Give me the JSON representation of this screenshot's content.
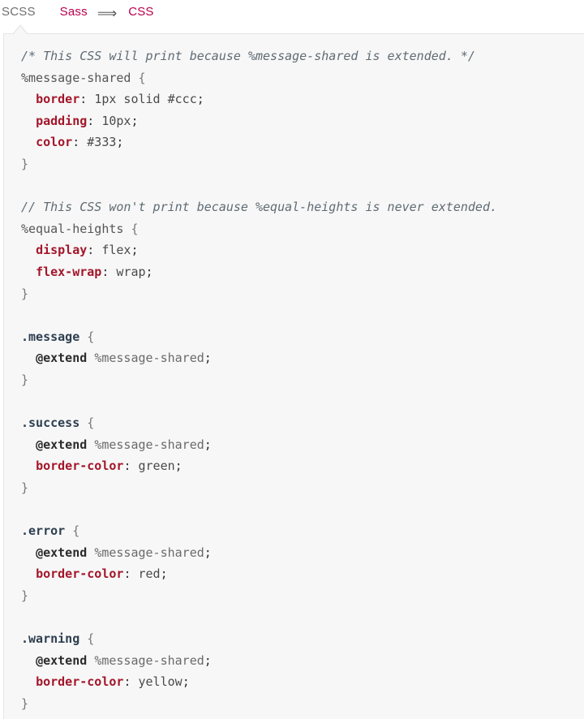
{
  "tabs": {
    "scss": "SCSS",
    "sass": "Sass",
    "arrow": "⟹",
    "css": "CSS"
  },
  "colors": {
    "tab_scss": "#6f6f6f",
    "tab_sass": "#b8004d",
    "tab_css": "#b8004d",
    "panel_bg": "#f7f7f7",
    "property": "#a3162a",
    "comment": "#5f6b73"
  },
  "code": {
    "lines": [
      {
        "kind": "comment",
        "text": "/* This CSS will print because %message-shared is extended. */"
      },
      {
        "kind": "placeholder-open",
        "selector": "%message-shared",
        "brace": " {"
      },
      {
        "kind": "decl",
        "prop": "border",
        "value": "1px solid #ccc"
      },
      {
        "kind": "decl",
        "prop": "padding",
        "value": "10px"
      },
      {
        "kind": "decl",
        "prop": "color",
        "value": "#333"
      },
      {
        "kind": "close",
        "text": "}"
      },
      {
        "kind": "blank",
        "text": ""
      },
      {
        "kind": "comment",
        "text": "// This CSS won't print because %equal-heights is never extended."
      },
      {
        "kind": "placeholder-open",
        "selector": "%equal-heights",
        "brace": " {"
      },
      {
        "kind": "decl",
        "prop": "display",
        "value": "flex"
      },
      {
        "kind": "decl",
        "prop": "flex-wrap",
        "value": "wrap"
      },
      {
        "kind": "close",
        "text": "}"
      },
      {
        "kind": "blank",
        "text": ""
      },
      {
        "kind": "class-open",
        "selector": ".message",
        "brace": " {"
      },
      {
        "kind": "extend",
        "at": "@extend",
        "target": "%message-shared"
      },
      {
        "kind": "close",
        "text": "}"
      },
      {
        "kind": "blank",
        "text": ""
      },
      {
        "kind": "class-open",
        "selector": ".success",
        "brace": " {"
      },
      {
        "kind": "extend",
        "at": "@extend",
        "target": "%message-shared"
      },
      {
        "kind": "decl",
        "prop": "border-color",
        "value": "green"
      },
      {
        "kind": "close",
        "text": "}"
      },
      {
        "kind": "blank",
        "text": ""
      },
      {
        "kind": "class-open",
        "selector": ".error",
        "brace": " {"
      },
      {
        "kind": "extend",
        "at": "@extend",
        "target": "%message-shared"
      },
      {
        "kind": "decl",
        "prop": "border-color",
        "value": "red"
      },
      {
        "kind": "close",
        "text": "}"
      },
      {
        "kind": "blank",
        "text": ""
      },
      {
        "kind": "class-open",
        "selector": ".warning",
        "brace": " {"
      },
      {
        "kind": "extend",
        "at": "@extend",
        "target": "%message-shared"
      },
      {
        "kind": "decl",
        "prop": "border-color",
        "value": "yellow"
      },
      {
        "kind": "close",
        "text": "}"
      }
    ]
  }
}
